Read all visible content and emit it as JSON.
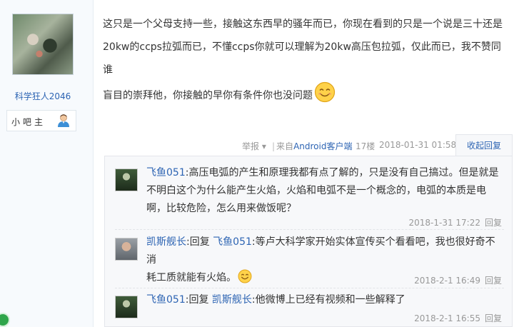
{
  "author": {
    "name": "科学狂人2046",
    "role": "小吧主"
  },
  "post": {
    "lines": [
      "这只是一个父母支持一些，接触这东西早的骚年而已，你现在看到的只是一个说是三十还是",
      "20kw的ccps拉弧而已，不懂ccps你就可以理解为20kw高压包拉弧，仅此而已，我不赞同谁",
      "盲目的崇拜他，你接触的早你有条件你也没问题"
    ],
    "emoji": "smile-emoji"
  },
  "tail": {
    "report": "举报",
    "separator": "|",
    "source_prefix": "来自",
    "source": "Android客户端",
    "floor": "17楼",
    "time": "2018-01-31 01:58",
    "collapse": "收起回复"
  },
  "replies": [
    {
      "name": "飞鱼051",
      "colon": ":",
      "prefix": "",
      "mention": "",
      "lines": [
        "高压电弧的产生和原理我都有点了解的，只是没有自己搞过。但是就是",
        "不明白这个为什么能产生火焰，火焰和电弧不是一个概念的，电弧的本质是电",
        "啊，比较危险，怎么用来做饭呢？"
      ],
      "time": "2018-1-31 17:22",
      "reply_label": "回复"
    },
    {
      "name": "凯斯舰长",
      "colon": ":",
      "prefix": "回复 ",
      "mention": "飞鱼051",
      "lines": [
        ":等卢大科学家开始实体宣传买个看看吧，我也很好奇不消",
        "耗工质就能有火焰。"
      ],
      "time": "2018-2-1 16:49",
      "reply_label": "回复"
    },
    {
      "name": "飞鱼051",
      "colon": ":",
      "prefix": "回复 ",
      "mention": "凯斯舰长",
      "lines": [
        ":他微博上已经有视频和一些解释了"
      ],
      "time": "2018-2-1 16:55",
      "reply_label": "回复"
    }
  ],
  "colors": {
    "link": "#2d64b3",
    "meta": "#999999",
    "reply_bg": "#f7f8fa"
  }
}
